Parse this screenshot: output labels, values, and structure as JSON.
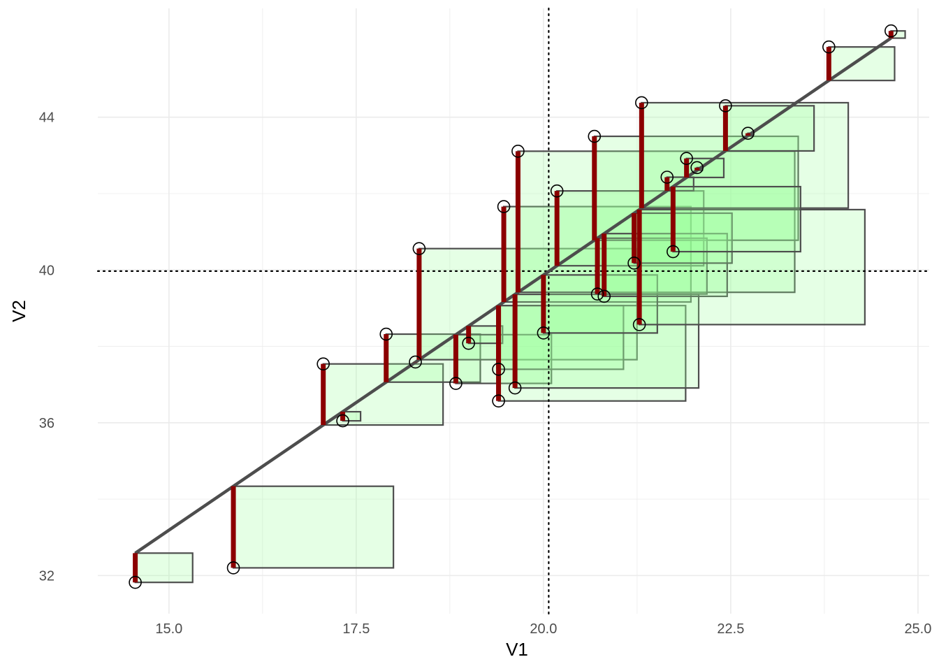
{
  "chart_data": {
    "type": "scatter",
    "xlabel": "V1",
    "ylabel": "V2",
    "xlim": [
      14.05,
      25.15
    ],
    "ylim": [
      31.0,
      46.85
    ],
    "x_ticks": [
      15.0,
      17.5,
      20.0,
      22.5,
      25.0
    ],
    "x_tick_labels": [
      "15.0",
      "17.5",
      "20.0",
      "22.5",
      "25.0"
    ],
    "y_ticks": [
      32,
      36,
      40,
      44
    ],
    "y_tick_labels": [
      "32",
      "36",
      "40",
      "44"
    ],
    "grid": true,
    "mean_x": 20.07,
    "mean_y": 39.97,
    "regression": {
      "intercept": 13.14,
      "slope": 1.3365,
      "x_range": [
        14.55,
        24.64
      ]
    },
    "points": [
      {
        "x": 14.55,
        "y": 31.82
      },
      {
        "x": 15.86,
        "y": 32.2
      },
      {
        "x": 17.06,
        "y": 37.54
      },
      {
        "x": 17.32,
        "y": 36.05
      },
      {
        "x": 17.9,
        "y": 38.32
      },
      {
        "x": 18.29,
        "y": 37.59
      },
      {
        "x": 18.34,
        "y": 40.56
      },
      {
        "x": 18.83,
        "y": 37.03
      },
      {
        "x": 19.0,
        "y": 38.08
      },
      {
        "x": 19.4,
        "y": 37.4
      },
      {
        "x": 19.4,
        "y": 36.57
      },
      {
        "x": 19.47,
        "y": 41.66
      },
      {
        "x": 19.62,
        "y": 36.91
      },
      {
        "x": 19.66,
        "y": 43.11
      },
      {
        "x": 20.0,
        "y": 38.35
      },
      {
        "x": 20.18,
        "y": 42.07
      },
      {
        "x": 20.68,
        "y": 43.5
      },
      {
        "x": 20.72,
        "y": 39.37
      },
      {
        "x": 20.81,
        "y": 39.31
      },
      {
        "x": 21.21,
        "y": 40.18
      },
      {
        "x": 21.28,
        "y": 38.57
      },
      {
        "x": 21.31,
        "y": 44.38
      },
      {
        "x": 21.65,
        "y": 42.43
      },
      {
        "x": 21.73,
        "y": 40.48
      },
      {
        "x": 21.91,
        "y": 42.92
      },
      {
        "x": 22.05,
        "y": 42.68
      },
      {
        "x": 22.43,
        "y": 44.3
      },
      {
        "x": 22.73,
        "y": 43.58
      },
      {
        "x": 23.81,
        "y": 45.84
      },
      {
        "x": 24.64,
        "y": 46.26
      }
    ],
    "colors": {
      "points": "#000000",
      "residuals": "#8b0000",
      "regression_line": "#4d4d4d",
      "squares_fill": "#99ff99",
      "squares_stroke": "#4d4d4d",
      "grid": "#ebebeb",
      "reference_lines": "#000000"
    }
  }
}
